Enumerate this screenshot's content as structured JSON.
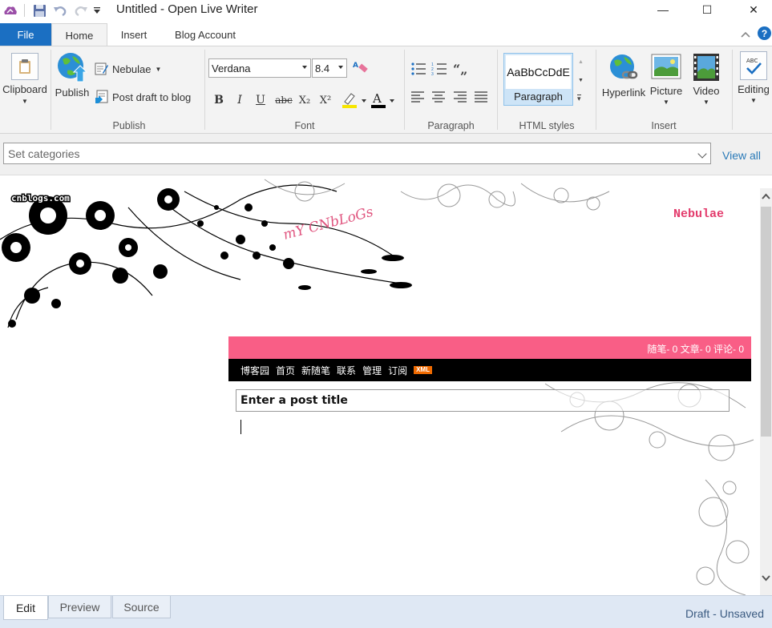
{
  "window": {
    "title": "Untitled - Open Live Writer",
    "minimize": "—",
    "maximize": "☐",
    "close": "✕"
  },
  "tabs": {
    "file": "File",
    "home": "Home",
    "insert": "Insert",
    "blog_account": "Blog Account"
  },
  "ribbon": {
    "clipboard": {
      "label": "Clipboard"
    },
    "publish_group": {
      "publish": "Publish",
      "blog_name": "Nebulae",
      "post_draft": "Post draft to blog",
      "group_label": "Publish"
    },
    "font_group": {
      "font_name": "Verdana",
      "font_size": "8.4",
      "group_label": "Font",
      "bold": "B",
      "italic": "I",
      "underline": "U",
      "strikethrough": "abc",
      "subscript": "X₂",
      "superscript": "X²",
      "highlight_color": "#f7e600",
      "font_color": "#000000"
    },
    "paragraph_group": {
      "group_label": "Paragraph"
    },
    "html_styles": {
      "preview_text": "AaBbCcDdE",
      "style_name": "Paragraph",
      "group_label": "HTML styles"
    },
    "insert_group": {
      "hyperlink": "Hyperlink",
      "picture": "Picture",
      "video": "Video",
      "group_label": "Insert"
    },
    "editing": {
      "label": "Editing"
    }
  },
  "categories": {
    "placeholder": "Set categories",
    "view_all": "View all"
  },
  "blog_template": {
    "blog_name": "Nebulae",
    "stats": "随笔- 0  文章- 0  评论- 0",
    "nav_items": [
      "博客园",
      "首页",
      "新随笔",
      "联系",
      "管理",
      "订阅"
    ],
    "xml_badge": "XML",
    "logo_text": "cnblogs.com",
    "decor_text": "mY CNbLoGs"
  },
  "post": {
    "title_placeholder": "Enter a post title"
  },
  "bottom": {
    "tab_edit": "Edit",
    "tab_preview": "Preview",
    "tab_source": "Source",
    "status": "Draft - Unsaved"
  },
  "colors": {
    "accent": "#1b6fc2",
    "stats_bar": "#f95e86",
    "nav_bar": "#000000",
    "blog_name": "#e33b6c"
  }
}
